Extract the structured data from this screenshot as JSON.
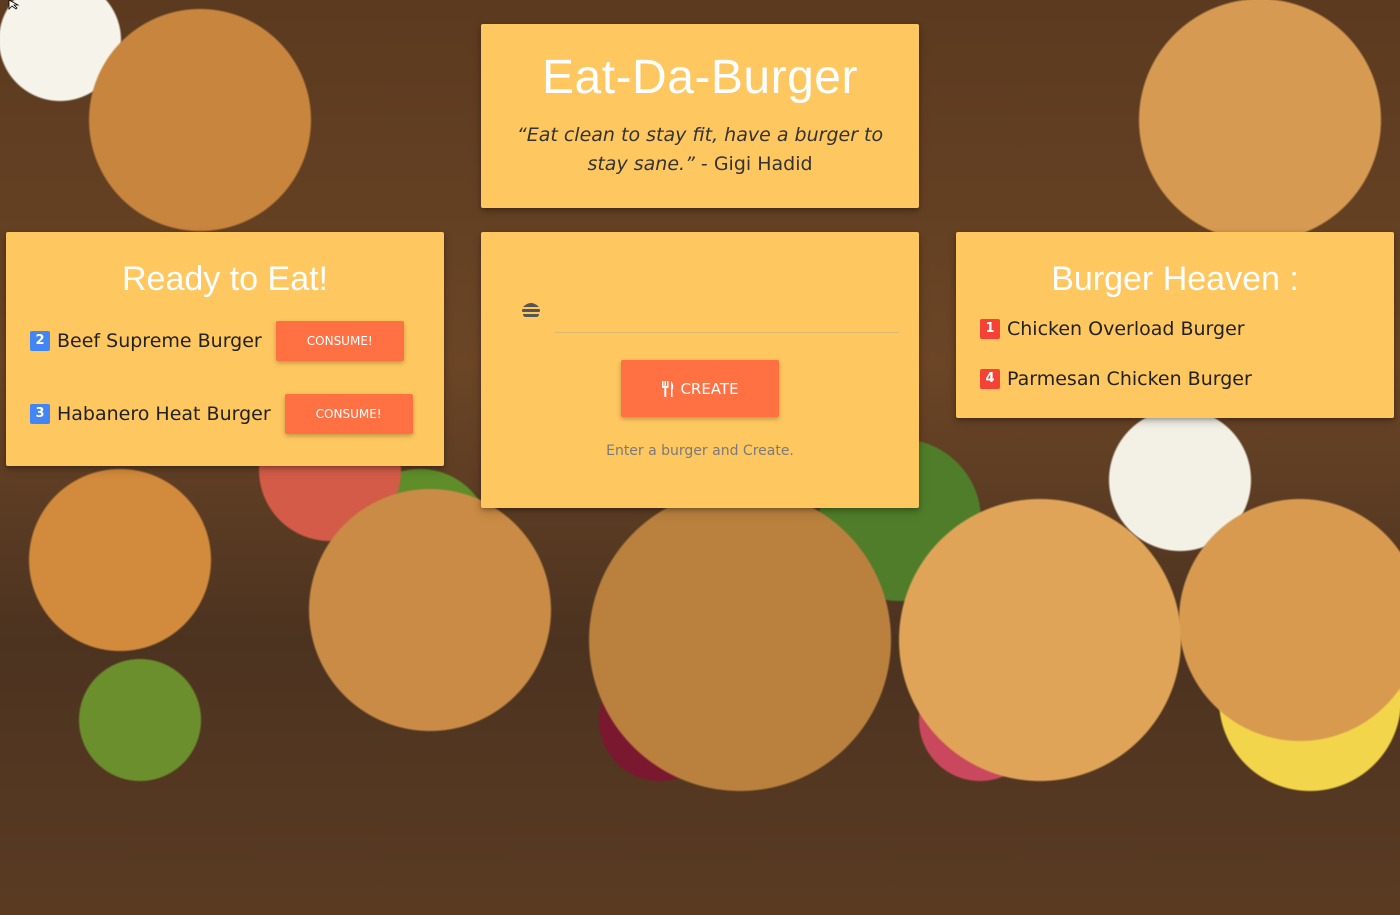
{
  "header": {
    "title": "Eat-Da-Burger",
    "quote": "“Eat clean to stay fit, have a burger to stay sane.”",
    "quote_author": " - Gigi Hadid"
  },
  "ready": {
    "title": "Ready to Eat!",
    "items": [
      {
        "id": "2",
        "name": "Beef Supreme Burger",
        "button": "CONSUME!"
      },
      {
        "id": "3",
        "name": "Habanero Heat Burger",
        "button": "CONSUME!"
      }
    ]
  },
  "create": {
    "input_value": "",
    "input_placeholder": "",
    "button_label": "CREATE",
    "helper": "Enter a burger and Create."
  },
  "heaven": {
    "title": "Burger Heaven :",
    "items": [
      {
        "id": "1",
        "name": "Chicken Overload Burger"
      },
      {
        "id": "4",
        "name": "Parmesan Chicken Burger"
      }
    ]
  },
  "colors": {
    "card": "#ffc75f",
    "button": "#ff7043",
    "badge_ready": "#4285f4",
    "badge_heaven": "#f44336"
  },
  "icons": {
    "input_icon": "burger-icon",
    "create_icon": "utensils-icon",
    "cursor": "mouse-cursor-icon"
  }
}
